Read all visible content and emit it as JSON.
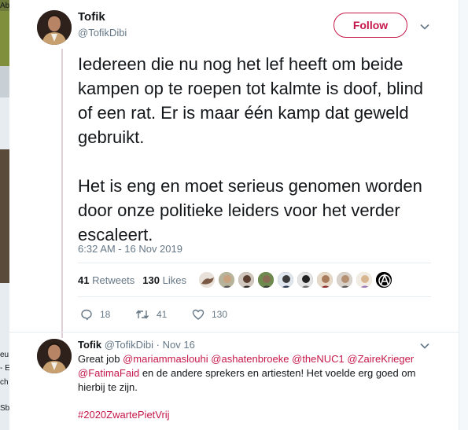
{
  "backdrop": {
    "left_fragments": [
      "Ab",
      "eu",
      "- E",
      "ch",
      "Sb"
    ]
  },
  "tweet": {
    "author_name": "Tofik",
    "author_handle": "@TofikDibi",
    "follow_label": "Follow",
    "text_paragraphs": [
      "Iedereen die nu nog het lef heeft om beide kampen op te roepen tot kalmte is doof, blind of een rat. Er is maar één kamp dat geweld gebruikt.",
      "Het is eng en moet serieus genomen worden door onze politieke leiders voor het verder escaleert."
    ],
    "timestamp": "6:32 AM - 16 Nov 2019",
    "retweets_count": "41",
    "retweets_label": "Retweets",
    "likes_count": "130",
    "likes_label": "Likes",
    "liker_icons": [
      "liker-1",
      "liker-2",
      "liker-3",
      "liker-4",
      "liker-5",
      "liker-6",
      "liker-7",
      "liker-8",
      "liker-9",
      "anarchy-symbol-avatar"
    ],
    "reply_count": "18",
    "retweet_action_count": "41",
    "like_action_count": "130"
  },
  "reply": {
    "author_name": "Tofik",
    "author_handle": "@TofikDibi",
    "separator": "·",
    "date": "Nov 16",
    "text_prefix": "Great job ",
    "mentions": [
      "@mariammaslouhi",
      "@ashatenbroeke",
      "@theNUC1",
      "@ZaireKrieger",
      "@FatimaFaid"
    ],
    "text_suffix": " en de andere sprekers en artiesten! Het voelde erg goed om hierbij te zijn.",
    "hashtag": "#2020ZwartePietVrij"
  },
  "colors": {
    "accent": "#c5164a",
    "muted": "#657786",
    "thread_line": "#dfcfd7",
    "text": "#14171a"
  }
}
